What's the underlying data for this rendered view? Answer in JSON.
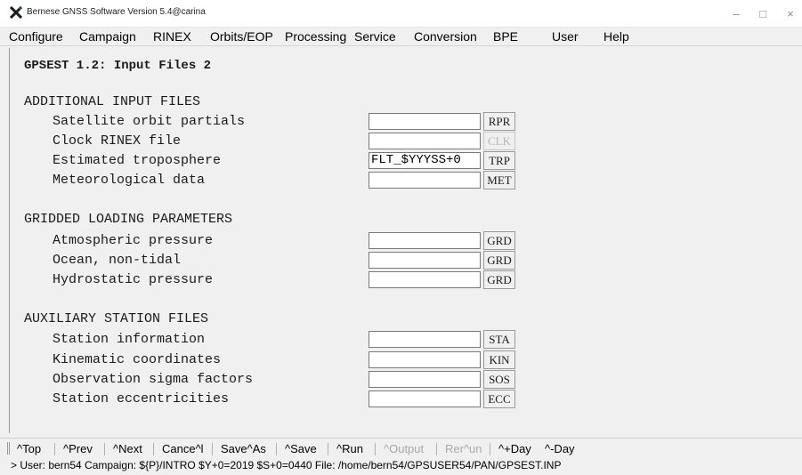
{
  "window": {
    "title": "Bernese GNSS Software Version 5.4@carina",
    "minimize": "–",
    "maximize": "□",
    "close": "×"
  },
  "menu": {
    "configure": "Configure",
    "campaign": "Campaign",
    "rinex": "RINEX",
    "orbits": "Orbits/EOP",
    "processing": "Processing",
    "service": "Service",
    "conversion": "Conversion",
    "bpe": "BPE",
    "user": "User",
    "help": "Help"
  },
  "panel": {
    "title": "GPSEST 1.2: Input Files 2",
    "sections": {
      "additional": "ADDITIONAL INPUT FILES",
      "gridded": "GRIDDED LOADING PARAMETERS",
      "auxiliary": "AUXILIARY STATION FILES"
    },
    "rows": {
      "sat_orbit": {
        "label": "Satellite orbit partials",
        "value": "",
        "button": "RPR"
      },
      "clock_rinex": {
        "label": "Clock RINEX file",
        "value": "",
        "button": "CLK"
      },
      "troposphere": {
        "label": "Estimated troposphere",
        "value": "FLT_$YYYSS+0",
        "button": "TRP"
      },
      "meteo": {
        "label": "Meteorological data",
        "value": "",
        "button": "MET"
      },
      "atm_pressure": {
        "label": "Atmospheric pressure",
        "value": "",
        "button": "GRD"
      },
      "ocean": {
        "label": "Ocean, non-tidal",
        "value": "",
        "button": "GRD"
      },
      "hydrostatic": {
        "label": "Hydrostatic pressure",
        "value": "",
        "button": "GRD"
      },
      "station_info": {
        "label": "Station information",
        "value": "",
        "button": "STA"
      },
      "kinematic": {
        "label": "Kinematic coordinates",
        "value": "",
        "button": "KIN"
      },
      "obs_sigma": {
        "label": "Observation sigma factors",
        "value": "",
        "button": "SOS"
      },
      "eccentricities": {
        "label": "Station eccentricities",
        "value": "",
        "button": "ECC"
      }
    }
  },
  "bottom_buttons": {
    "top": "^Top",
    "prev": "^Prev",
    "next": "^Next",
    "cancel": "Cance^l",
    "save_as": "Save^As",
    "save": "^Save",
    "run": "^Run",
    "output": "^Output",
    "rerun": "Rer^un",
    "plus_day": "^+Day",
    "minus_day": "^-Day"
  },
  "status": {
    "line": "> User: bern54  Campaign: ${P}/INTRO  $Y+0=2019  $S+0=0440  File: /home/bern54/GPSUSER54/PAN/GPSEST.INP"
  }
}
